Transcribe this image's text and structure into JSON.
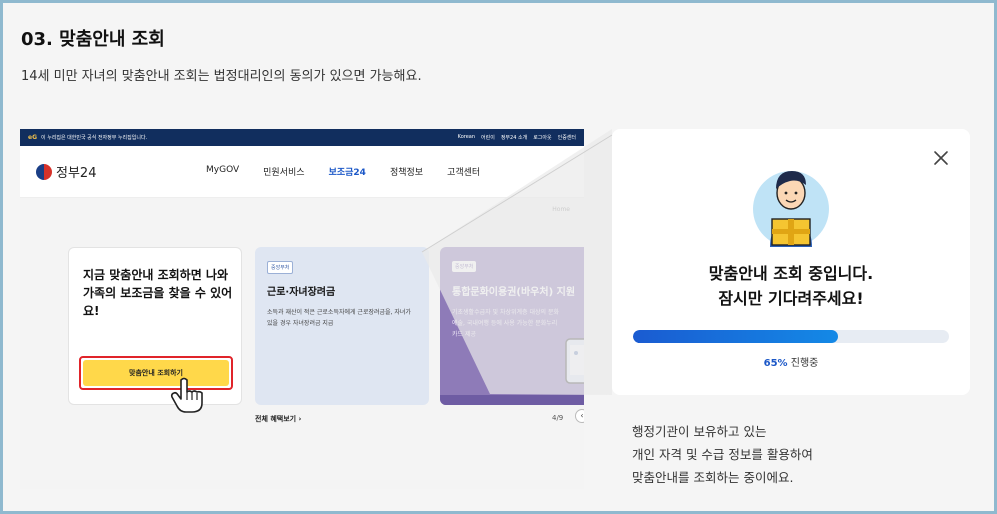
{
  "step": {
    "title": "03. 맞춤안내 조회",
    "description": "14세 미만 자녀의 맞춤안내 조회는 법정대리인의 동의가 있으면 가능해요."
  },
  "site": {
    "gov_bar": {
      "logo": "eG",
      "notice": "이 누리집은 대한민국 공식 전자정부 누리집입니다.",
      "links": [
        "Korean",
        "어린이",
        "정부24 소개",
        "로그아웃",
        "인증센터"
      ]
    },
    "logo_text": "정부24",
    "nav": [
      "MyGOV",
      "민원서비스",
      "보조금24",
      "정책정보",
      "고객센터"
    ],
    "nav_active": "보조금24",
    "breadcrumb": "Home",
    "promo": {
      "text": "지금 맞춤안내 조회하면 나와 가족의 보조금을 찾을 수 있어요!",
      "button_label": "맞춤안내 조회하기"
    },
    "cards": [
      {
        "tag": "중앙부처",
        "title": "근로·자녀장려금",
        "desc": "소득과 재산이 적은 근로소득자에게 근로장려금을, 자녀가 있을 경우 자녀장려금 지급"
      },
      {
        "tag": "중앙부처",
        "title": "통합문화이용권(바우처) 지원",
        "desc": "기초생활수급자 및 차상위계층 대상의 문화 예술, 국내여행 등에 사용 가능한 문화누리카드 제공"
      }
    ],
    "benefits_link": "전체 혜택보기",
    "pager": "4/9"
  },
  "modal": {
    "title_line1": "맞춤안내 조회 중입니다.",
    "title_line2": "잠시만 기다려주세요!",
    "progress_percent": 65,
    "progress_pct_label": "65%",
    "progress_suffix": " 진행중"
  },
  "note": {
    "line1": "행정기관이 보유하고 있는",
    "line2": "개인 자격 및 수급 정보를 활용하여",
    "line3": "맞춤안내를 조회하는 중이에요."
  },
  "colors": {
    "frame": "#8fb9cf",
    "gov_bar": "#112e5e",
    "accent": "#1b57c7",
    "button": "#ffd84a",
    "highlight": "#e0242a"
  },
  "icons": [
    "eg-logo-icon",
    "gov24-logo-icon",
    "hand-pointer-icon",
    "phone-icon",
    "close-icon",
    "person-with-box-icon"
  ]
}
